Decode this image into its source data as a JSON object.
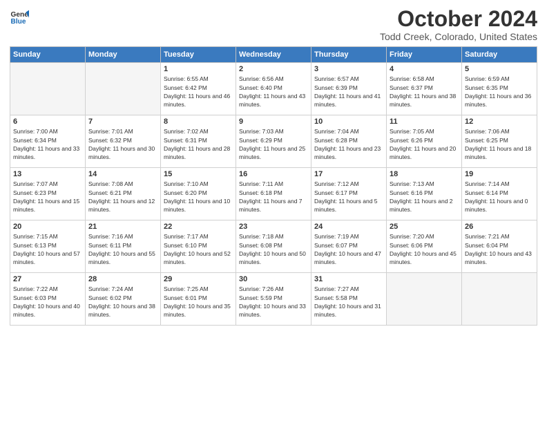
{
  "header": {
    "logo_line1": "General",
    "logo_line2": "Blue",
    "month_title": "October 2024",
    "location": "Todd Creek, Colorado, United States"
  },
  "days_of_week": [
    "Sunday",
    "Monday",
    "Tuesday",
    "Wednesday",
    "Thursday",
    "Friday",
    "Saturday"
  ],
  "weeks": [
    [
      {
        "day": "",
        "empty": true
      },
      {
        "day": "",
        "empty": true
      },
      {
        "day": "1",
        "sunrise": "Sunrise: 6:55 AM",
        "sunset": "Sunset: 6:42 PM",
        "daylight": "Daylight: 11 hours and 46 minutes."
      },
      {
        "day": "2",
        "sunrise": "Sunrise: 6:56 AM",
        "sunset": "Sunset: 6:40 PM",
        "daylight": "Daylight: 11 hours and 43 minutes."
      },
      {
        "day": "3",
        "sunrise": "Sunrise: 6:57 AM",
        "sunset": "Sunset: 6:39 PM",
        "daylight": "Daylight: 11 hours and 41 minutes."
      },
      {
        "day": "4",
        "sunrise": "Sunrise: 6:58 AM",
        "sunset": "Sunset: 6:37 PM",
        "daylight": "Daylight: 11 hours and 38 minutes."
      },
      {
        "day": "5",
        "sunrise": "Sunrise: 6:59 AM",
        "sunset": "Sunset: 6:35 PM",
        "daylight": "Daylight: 11 hours and 36 minutes."
      }
    ],
    [
      {
        "day": "6",
        "sunrise": "Sunrise: 7:00 AM",
        "sunset": "Sunset: 6:34 PM",
        "daylight": "Daylight: 11 hours and 33 minutes."
      },
      {
        "day": "7",
        "sunrise": "Sunrise: 7:01 AM",
        "sunset": "Sunset: 6:32 PM",
        "daylight": "Daylight: 11 hours and 30 minutes."
      },
      {
        "day": "8",
        "sunrise": "Sunrise: 7:02 AM",
        "sunset": "Sunset: 6:31 PM",
        "daylight": "Daylight: 11 hours and 28 minutes."
      },
      {
        "day": "9",
        "sunrise": "Sunrise: 7:03 AM",
        "sunset": "Sunset: 6:29 PM",
        "daylight": "Daylight: 11 hours and 25 minutes."
      },
      {
        "day": "10",
        "sunrise": "Sunrise: 7:04 AM",
        "sunset": "Sunset: 6:28 PM",
        "daylight": "Daylight: 11 hours and 23 minutes."
      },
      {
        "day": "11",
        "sunrise": "Sunrise: 7:05 AM",
        "sunset": "Sunset: 6:26 PM",
        "daylight": "Daylight: 11 hours and 20 minutes."
      },
      {
        "day": "12",
        "sunrise": "Sunrise: 7:06 AM",
        "sunset": "Sunset: 6:25 PM",
        "daylight": "Daylight: 11 hours and 18 minutes."
      }
    ],
    [
      {
        "day": "13",
        "sunrise": "Sunrise: 7:07 AM",
        "sunset": "Sunset: 6:23 PM",
        "daylight": "Daylight: 11 hours and 15 minutes."
      },
      {
        "day": "14",
        "sunrise": "Sunrise: 7:08 AM",
        "sunset": "Sunset: 6:21 PM",
        "daylight": "Daylight: 11 hours and 12 minutes."
      },
      {
        "day": "15",
        "sunrise": "Sunrise: 7:10 AM",
        "sunset": "Sunset: 6:20 PM",
        "daylight": "Daylight: 11 hours and 10 minutes."
      },
      {
        "day": "16",
        "sunrise": "Sunrise: 7:11 AM",
        "sunset": "Sunset: 6:18 PM",
        "daylight": "Daylight: 11 hours and 7 minutes."
      },
      {
        "day": "17",
        "sunrise": "Sunrise: 7:12 AM",
        "sunset": "Sunset: 6:17 PM",
        "daylight": "Daylight: 11 hours and 5 minutes."
      },
      {
        "day": "18",
        "sunrise": "Sunrise: 7:13 AM",
        "sunset": "Sunset: 6:16 PM",
        "daylight": "Daylight: 11 hours and 2 minutes."
      },
      {
        "day": "19",
        "sunrise": "Sunrise: 7:14 AM",
        "sunset": "Sunset: 6:14 PM",
        "daylight": "Daylight: 11 hours and 0 minutes."
      }
    ],
    [
      {
        "day": "20",
        "sunrise": "Sunrise: 7:15 AM",
        "sunset": "Sunset: 6:13 PM",
        "daylight": "Daylight: 10 hours and 57 minutes."
      },
      {
        "day": "21",
        "sunrise": "Sunrise: 7:16 AM",
        "sunset": "Sunset: 6:11 PM",
        "daylight": "Daylight: 10 hours and 55 minutes."
      },
      {
        "day": "22",
        "sunrise": "Sunrise: 7:17 AM",
        "sunset": "Sunset: 6:10 PM",
        "daylight": "Daylight: 10 hours and 52 minutes."
      },
      {
        "day": "23",
        "sunrise": "Sunrise: 7:18 AM",
        "sunset": "Sunset: 6:08 PM",
        "daylight": "Daylight: 10 hours and 50 minutes."
      },
      {
        "day": "24",
        "sunrise": "Sunrise: 7:19 AM",
        "sunset": "Sunset: 6:07 PM",
        "daylight": "Daylight: 10 hours and 47 minutes."
      },
      {
        "day": "25",
        "sunrise": "Sunrise: 7:20 AM",
        "sunset": "Sunset: 6:06 PM",
        "daylight": "Daylight: 10 hours and 45 minutes."
      },
      {
        "day": "26",
        "sunrise": "Sunrise: 7:21 AM",
        "sunset": "Sunset: 6:04 PM",
        "daylight": "Daylight: 10 hours and 43 minutes."
      }
    ],
    [
      {
        "day": "27",
        "sunrise": "Sunrise: 7:22 AM",
        "sunset": "Sunset: 6:03 PM",
        "daylight": "Daylight: 10 hours and 40 minutes."
      },
      {
        "day": "28",
        "sunrise": "Sunrise: 7:24 AM",
        "sunset": "Sunset: 6:02 PM",
        "daylight": "Daylight: 10 hours and 38 minutes."
      },
      {
        "day": "29",
        "sunrise": "Sunrise: 7:25 AM",
        "sunset": "Sunset: 6:01 PM",
        "daylight": "Daylight: 10 hours and 35 minutes."
      },
      {
        "day": "30",
        "sunrise": "Sunrise: 7:26 AM",
        "sunset": "Sunset: 5:59 PM",
        "daylight": "Daylight: 10 hours and 33 minutes."
      },
      {
        "day": "31",
        "sunrise": "Sunrise: 7:27 AM",
        "sunset": "Sunset: 5:58 PM",
        "daylight": "Daylight: 10 hours and 31 minutes."
      },
      {
        "day": "",
        "empty": true
      },
      {
        "day": "",
        "empty": true
      }
    ]
  ]
}
